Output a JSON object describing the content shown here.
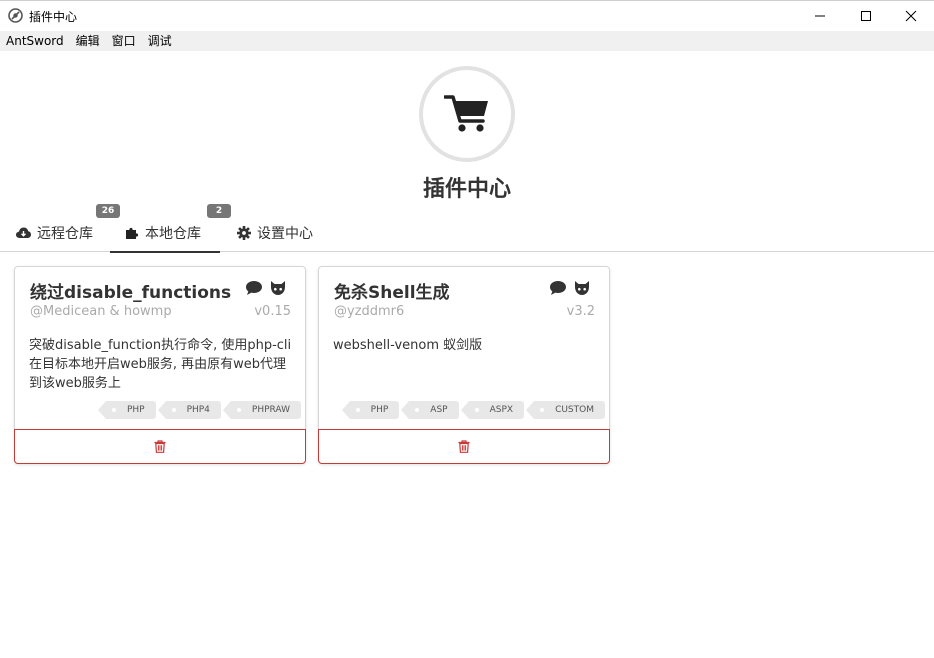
{
  "window": {
    "title": "插件中心"
  },
  "menubar": {
    "items": [
      "AntSword",
      "编辑",
      "窗口",
      "调试"
    ]
  },
  "header": {
    "title": "插件中心",
    "icon": "shopping-cart-icon"
  },
  "tabs": [
    {
      "label": "远程仓库",
      "badge": "26",
      "icon": "cloud-download-icon"
    },
    {
      "label": "本地仓库",
      "badge": "2",
      "icon": "puzzle-icon",
      "active": true
    },
    {
      "label": "设置中心",
      "icon": "gear-icon"
    }
  ],
  "plugins": [
    {
      "title": "绕过disable_functions",
      "author": "@Medicean & howmp",
      "version": "v0.15",
      "description": "突破disable_function执行命令, 使用php-cli在目标本地开启web服务, 再由原有web代理到该web服务上",
      "tags": [
        "PHP",
        "PHP4",
        "PHPRAW"
      ]
    },
    {
      "title": "免杀Shell生成",
      "author": "@yzddmr6",
      "version": "v3.2",
      "description": "webshell-venom 蚁剑版",
      "tags": [
        "PHP",
        "ASP",
        "ASPX",
        "CUSTOM"
      ]
    }
  ],
  "colors": {
    "delete": "#c73a3a",
    "badge": "#767676",
    "tag_bg": "#e8e8e8"
  }
}
